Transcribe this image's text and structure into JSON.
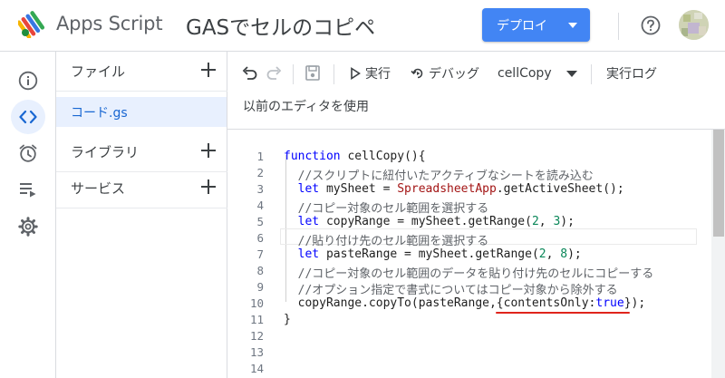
{
  "header": {
    "brand": "Apps Script",
    "project_title": "GASでセルのコピペ",
    "deploy_label": "デプロイ",
    "icons": [
      "apps-script-logo",
      "help-icon",
      "avatar"
    ],
    "colors": {
      "deploy": "#4285f4",
      "selection": "#e8f0fe",
      "underline": "#e0241c"
    }
  },
  "rail": {
    "items": [
      {
        "name": "overview",
        "icon": "info-icon",
        "active": false
      },
      {
        "name": "editor",
        "icon": "code-icon",
        "active": true
      },
      {
        "name": "triggers",
        "icon": "alarm-icon",
        "active": false
      },
      {
        "name": "executions",
        "icon": "executions-icon",
        "active": false
      },
      {
        "name": "settings",
        "icon": "gear-icon",
        "active": false
      }
    ]
  },
  "files": {
    "files_label": "ファイル",
    "file_name": "コード.gs",
    "libraries_label": "ライブラリ",
    "services_label": "サービス"
  },
  "toolbar": {
    "run_label": "実行",
    "debug_label": "デバッグ",
    "function_name": "cellCopy",
    "log_label": "実行ログ",
    "legacy_editor_label": "以前のエディタを使用"
  },
  "editor": {
    "line_numbers": [
      "1",
      "2",
      "3",
      "4",
      "5",
      "6",
      "7",
      "8",
      "9",
      "10",
      "11",
      "12",
      "13",
      "14"
    ],
    "lines": [
      "function cellCopy(){",
      "  //スクリプトに紐付いたアクティブなシートを読み込む",
      "  let mySheet = SpreadsheetApp.getActiveSheet();",
      "  //コピー対象のセル範囲を選択する",
      "  let copyRange = mySheet.getRange(2, 3);",
      "  //貼り付け先のセル範囲を選択する",
      "  let pasteRange = mySheet.getRange(2, 8);",
      "  //コピー対象のセル範囲のデータを貼り付け先のセルにコピーする",
      "  //オプション指定で書式についてはコピー対象から除外する",
      "  copyRange.copyTo(pasteRange,{contentsOnly:true});",
      "}",
      "",
      "",
      ""
    ]
  }
}
